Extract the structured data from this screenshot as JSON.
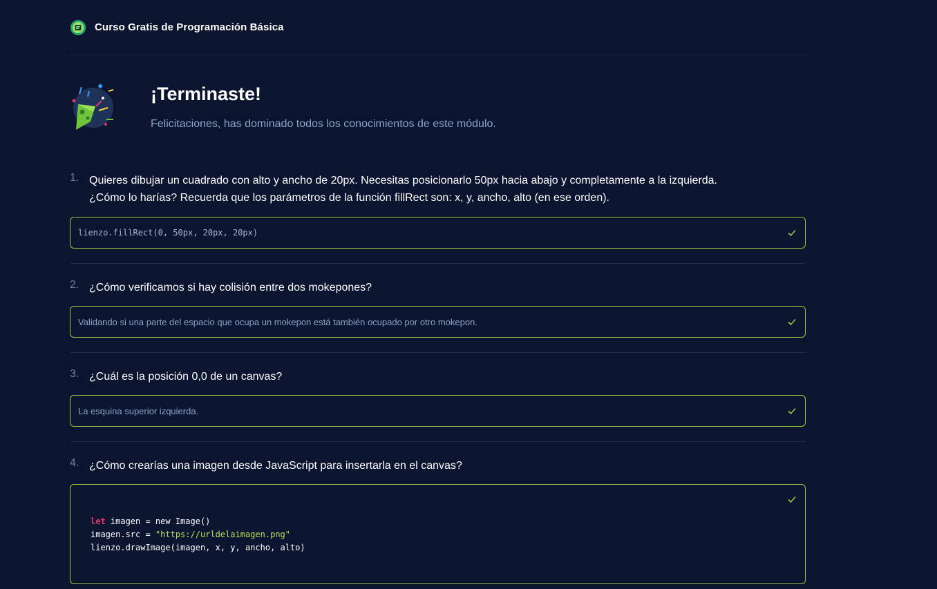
{
  "header": {
    "course_title": "Curso Gratis de Programación Básica",
    "logo_icon": "course-badge-icon"
  },
  "finish": {
    "title": "¡Terminaste!",
    "subtitle": "Felicitaciones, has dominado todos los conocimientos de este módulo.",
    "icon": "party-popper-icon"
  },
  "questions": [
    {
      "number": "1.",
      "text_line1": "Quieres dibujar un cuadrado con alto y ancho de 20px. Necesitas posicionarlo 50px hacia abajo y completamente a la izquierda.",
      "text_line2": "¿Cómo lo harías? Recuerda que los parámetros de la función fillRect son: x, y, ancho, alto (en ese orden).",
      "answer": "lienzo.fillRect(0, 50px, 20px, 20px)",
      "status": "correct"
    },
    {
      "number": "2.",
      "text": "¿Cómo verificamos si hay colisión entre dos mokepones?",
      "answer": "Validando si una parte del espacio que ocupa un mokepon está también ocupado por otro mokepon.",
      "status": "correct"
    },
    {
      "number": "3.",
      "text": "¿Cuál es la posición 0,0 de un canvas?",
      "answer": "La esquina superior izquierda.",
      "status": "correct"
    },
    {
      "number": "4.",
      "text": "¿Cómo crearías una imagen desde JavaScript para insertarla en el canvas?",
      "code": {
        "line1_kw": "let",
        "line1_rest": " imagen = new Image()",
        "line2_pre": "imagen.src = ",
        "line2_str": "\"https://urldelaimagen.png\"",
        "line3": "lienzo.drawImage(imagen, x, y, ancho, alto)"
      },
      "status": "correct"
    }
  ],
  "colors": {
    "background": "#0b1530",
    "correct_border": "#98ca3f",
    "muted_text": "#8fa3c7",
    "keyword": "#e6336a",
    "string": "#b6e35a"
  }
}
